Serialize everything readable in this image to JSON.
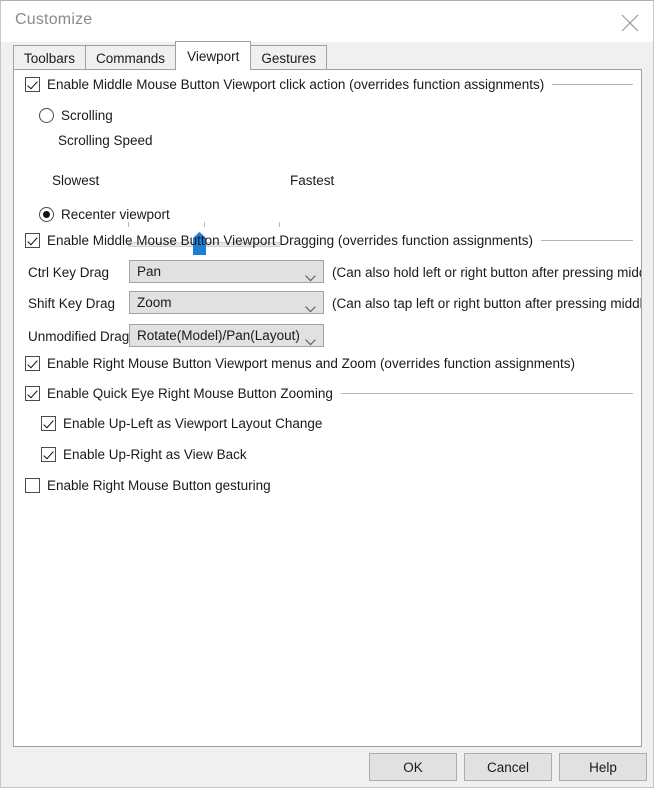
{
  "window": {
    "title": "Customize",
    "close_icon": "close-icon"
  },
  "tabs": [
    {
      "label": "Toolbars",
      "active": false
    },
    {
      "label": "Commands",
      "active": false
    },
    {
      "label": "Viewport",
      "active": true
    },
    {
      "label": "Gestures",
      "active": false
    }
  ],
  "viewport": {
    "middle_click_group": {
      "label": "Enable Middle Mouse Button Viewport click action (overrides function assignments)",
      "checked": true
    },
    "scrolling_radio": {
      "label": "Scrolling",
      "selected": false
    },
    "scrolling_speed_label": "Scrolling Speed",
    "slider": {
      "slowest_label": "Slowest",
      "fastest_label": "Fastest",
      "value_percent": 47,
      "min": 0,
      "max": 100,
      "tick_percent": [
        0,
        50,
        100
      ]
    },
    "recenter_radio": {
      "label": "Recenter viewport",
      "selected": true
    },
    "dragging_group": {
      "label": "Enable Middle Mouse Button Viewport Dragging (overrides function assignments)",
      "checked": true
    },
    "drag_rows": [
      {
        "label": "Ctrl Key Drag",
        "value": "Pan",
        "hint": "(Can also hold left or right button after pressing middle)"
      },
      {
        "label": "Shift Key Drag",
        "value": "Zoom",
        "hint": "(Can also tap left or right button after pressing middle)"
      },
      {
        "label": "Unmodified Drag",
        "value": "Rotate(Model)/Pan(Layout)",
        "hint": ""
      }
    ],
    "right_menus_checkbox": {
      "label": "Enable Right Mouse Button Viewport menus and Zoom (overrides function assignments)",
      "checked": true
    },
    "quick_eye_group": {
      "label": "Enable Quick Eye Right Mouse Button Zooming",
      "checked": true
    },
    "up_left_checkbox": {
      "label": "Enable Up-Left as Viewport Layout Change",
      "checked": true
    },
    "up_right_checkbox": {
      "label": "Enable Up-Right as View Back",
      "checked": true
    },
    "gesturing_checkbox": {
      "label": "Enable Right Mouse Button gesturing",
      "checked": false
    }
  },
  "footer": {
    "ok_label": "OK",
    "cancel_label": "Cancel",
    "help_label": "Help"
  },
  "colors": {
    "accent": "#1b7fd4",
    "window_bg": "#f0f0f0",
    "panel_bg": "#ffffff",
    "control_bg": "#e1e1e1",
    "border": "#a0a0a0"
  }
}
